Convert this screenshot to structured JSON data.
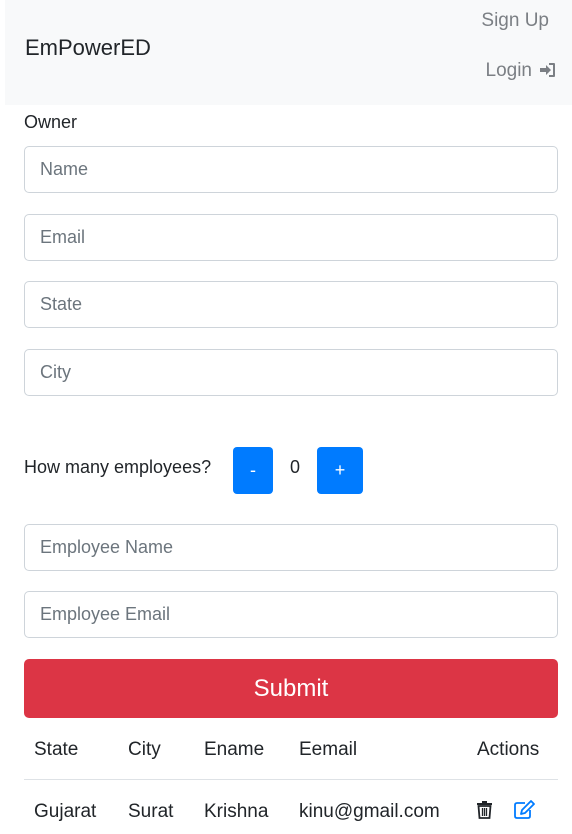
{
  "navbar": {
    "brand": "EmPowerED",
    "signup_label": "Sign Up",
    "login_label": "Login",
    "login_icon": "sign-in-icon"
  },
  "form": {
    "section_label": "Owner",
    "name_placeholder": "Name",
    "email_placeholder": "Email",
    "state_placeholder": "State",
    "city_placeholder": "City",
    "employee_count_label": "How many employees?",
    "decrement_label": "-",
    "increment_label": "+",
    "employee_count": "0",
    "employee_name_placeholder": "Employee Name",
    "employee_email_placeholder": "Employee Email",
    "submit_label": "Submit"
  },
  "table": {
    "headers": {
      "state": "State",
      "city": "City",
      "ename": "Ename",
      "eemail": "Eemail",
      "actions": "Actions"
    },
    "rows": [
      {
        "state": "Gujarat",
        "city": "Surat",
        "ename": "Krishna",
        "eemail": "kinu@gmail.com",
        "actions": [
          "trash-icon",
          "edit-icon"
        ]
      }
    ]
  },
  "colors": {
    "primary": "#007bff",
    "danger": "#dc3545",
    "navbar_bg": "#f8f9fa"
  }
}
